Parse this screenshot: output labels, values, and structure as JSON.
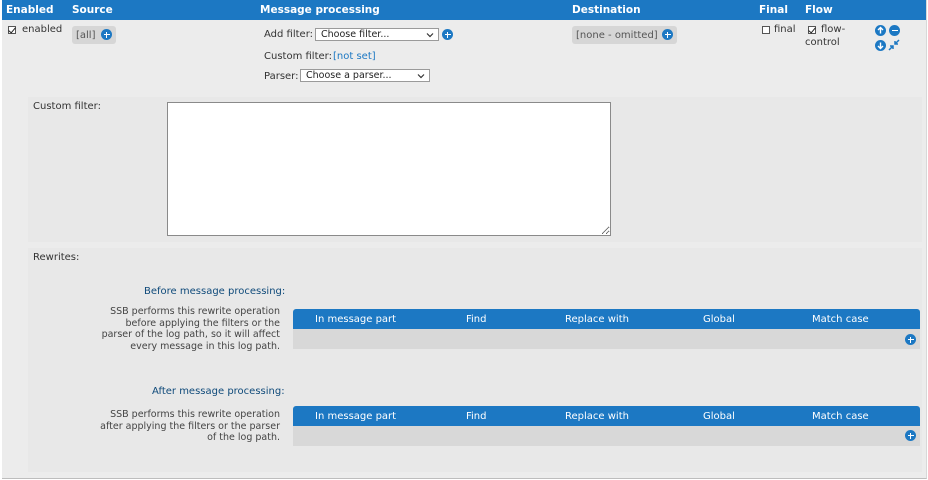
{
  "header": {
    "enabled": "Enabled",
    "source": "Source",
    "message_processing": "Message processing",
    "destination": "Destination",
    "final": "Final",
    "flow": "Flow"
  },
  "row": {
    "enabled_label": "enabled",
    "source_value": "[all]",
    "add_filter_label": "Add filter:",
    "add_filter_select": "Choose filter...",
    "custom_filter_label": "Custom filter:",
    "custom_filter_value": "[not set]",
    "parser_label": "Parser:",
    "parser_select": "Choose a parser...",
    "destination_value": "[none - omitted]",
    "final_label": "final",
    "flow_control_line1": "flow-",
    "flow_control_line2": "control"
  },
  "custom_filter_panel": {
    "label": "Custom filter:",
    "value": ""
  },
  "rewrites": {
    "label": "Rewrites:",
    "before": {
      "title": "Before message processing:",
      "description_lines": [
        "SSB performs this rewrite operation",
        "before applying the filters or the",
        "parser of the log path, so it will affect",
        "every message in this log path."
      ]
    },
    "after": {
      "title": "After message processing:",
      "description_lines": [
        "SSB performs this rewrite operation",
        "after applying the filters or the parser",
        "of the log path."
      ]
    },
    "columns": [
      "In message part",
      "Find",
      "Replace with",
      "Global",
      "Match case"
    ]
  },
  "colors": {
    "accent": "#1c78c3",
    "header_text": "#ffffff",
    "panel_bg": "#e8e8e8"
  }
}
